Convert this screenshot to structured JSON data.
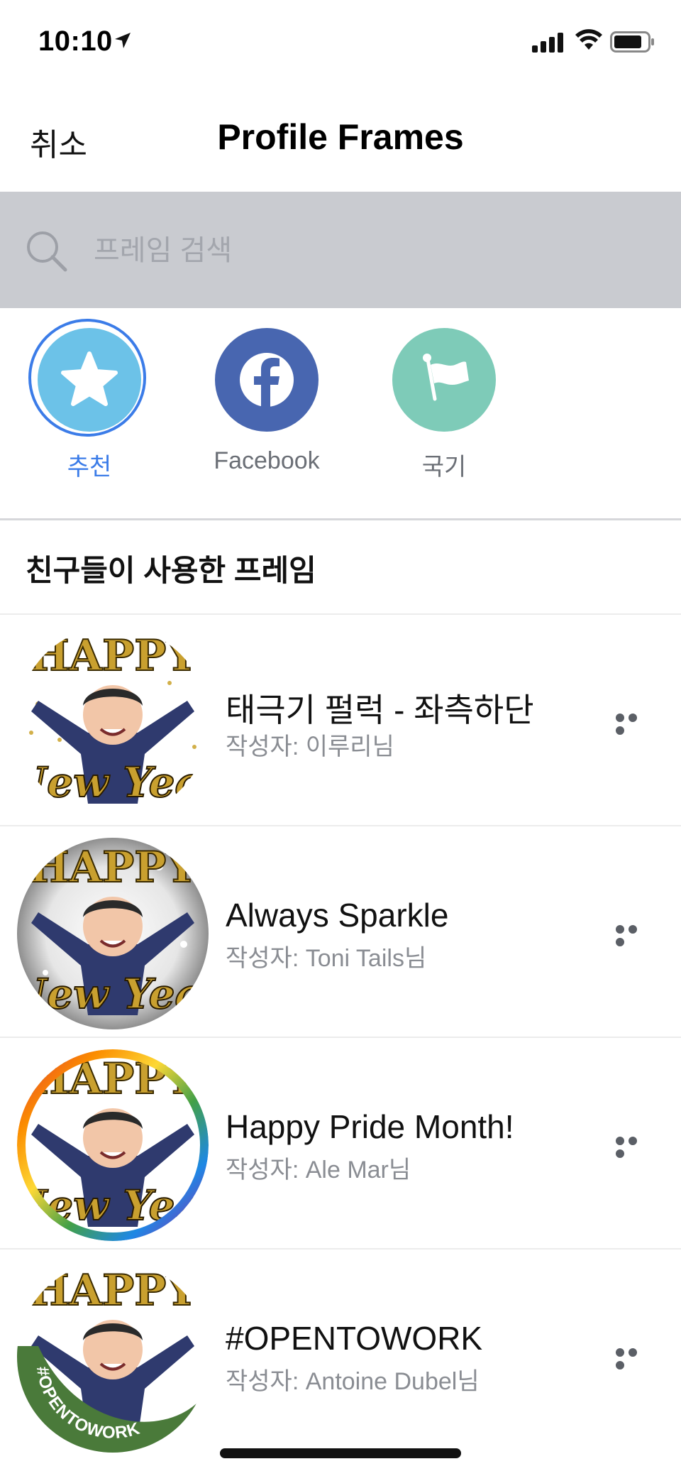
{
  "status_bar": {
    "time": "10:10"
  },
  "nav": {
    "cancel_label": "취소",
    "title": "Profile Frames"
  },
  "search": {
    "placeholder": "프레임 검색",
    "value": ""
  },
  "categories": [
    {
      "label": "추천",
      "icon": "star-icon",
      "color": "#6cc2e8",
      "selected": true
    },
    {
      "label": "Facebook",
      "icon": "facebook-icon",
      "color": "#4866b0",
      "selected": false
    },
    {
      "label": "국기",
      "icon": "flag-icon",
      "color": "#7ecbb8",
      "selected": false
    }
  ],
  "section": {
    "title": "친구들이 사용한 프레임"
  },
  "frames": [
    {
      "title": "태극기 펄럭 - 좌측하단",
      "author": "작성자: 이루리님"
    },
    {
      "title": "Always Sparkle",
      "author": "작성자: Toni Tails님"
    },
    {
      "title": "Happy Pride Month!",
      "author": "작성자: Ale Mar님"
    },
    {
      "title": "#OPENTOWORK",
      "author": "작성자: Antoine Dubel님",
      "badge_text": "#OPENTOWORK"
    }
  ],
  "thumbnail_text": {
    "top": "HAPPY",
    "bottom": "New Year"
  },
  "colors": {
    "accent": "#3b7ce8",
    "search_bg": "#c9cbd0"
  }
}
